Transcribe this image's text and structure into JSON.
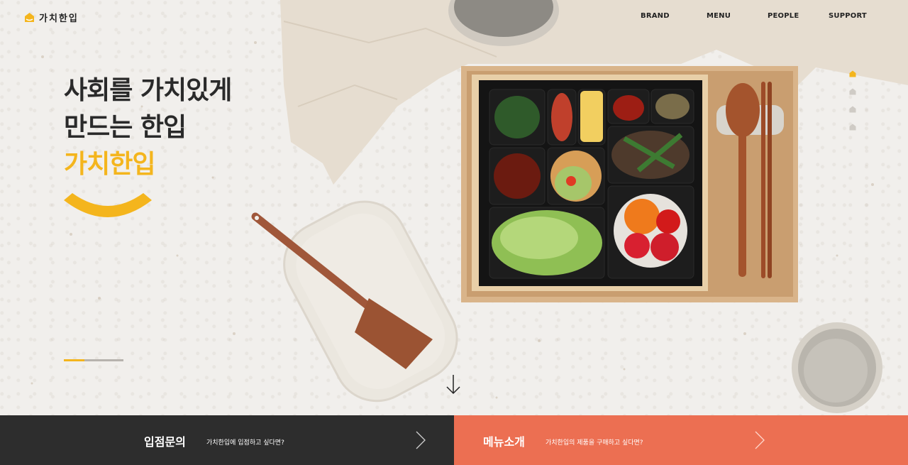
{
  "header": {
    "logo_text": "가치한입",
    "nav": [
      {
        "label": "BRAND"
      },
      {
        "label": "MENU"
      },
      {
        "label": "PEOPLE"
      },
      {
        "label": "SUPPORT"
      }
    ]
  },
  "hero": {
    "headline_line1": "사회를 가치있게",
    "headline_line2": "만드는 한입",
    "headline_accent": "가치한입",
    "slide_progress": 0.35,
    "slide_count": 4,
    "active_slide": 1
  },
  "cta": {
    "left": {
      "title": "입점문의",
      "subtitle": "가치한입에 입점하고 싶다면?"
    },
    "right": {
      "title": "메뉴소개",
      "subtitle": "가치한입의 제품을 구매하고 싶다면?"
    }
  },
  "colors": {
    "accent": "#f4b51d",
    "dark_bar": "#2d2d2d",
    "coral_bar": "#ec6f52",
    "text": "#222222"
  },
  "icons": [
    "logo-house-icon",
    "chevron-right-icon",
    "arrow-down-icon"
  ]
}
